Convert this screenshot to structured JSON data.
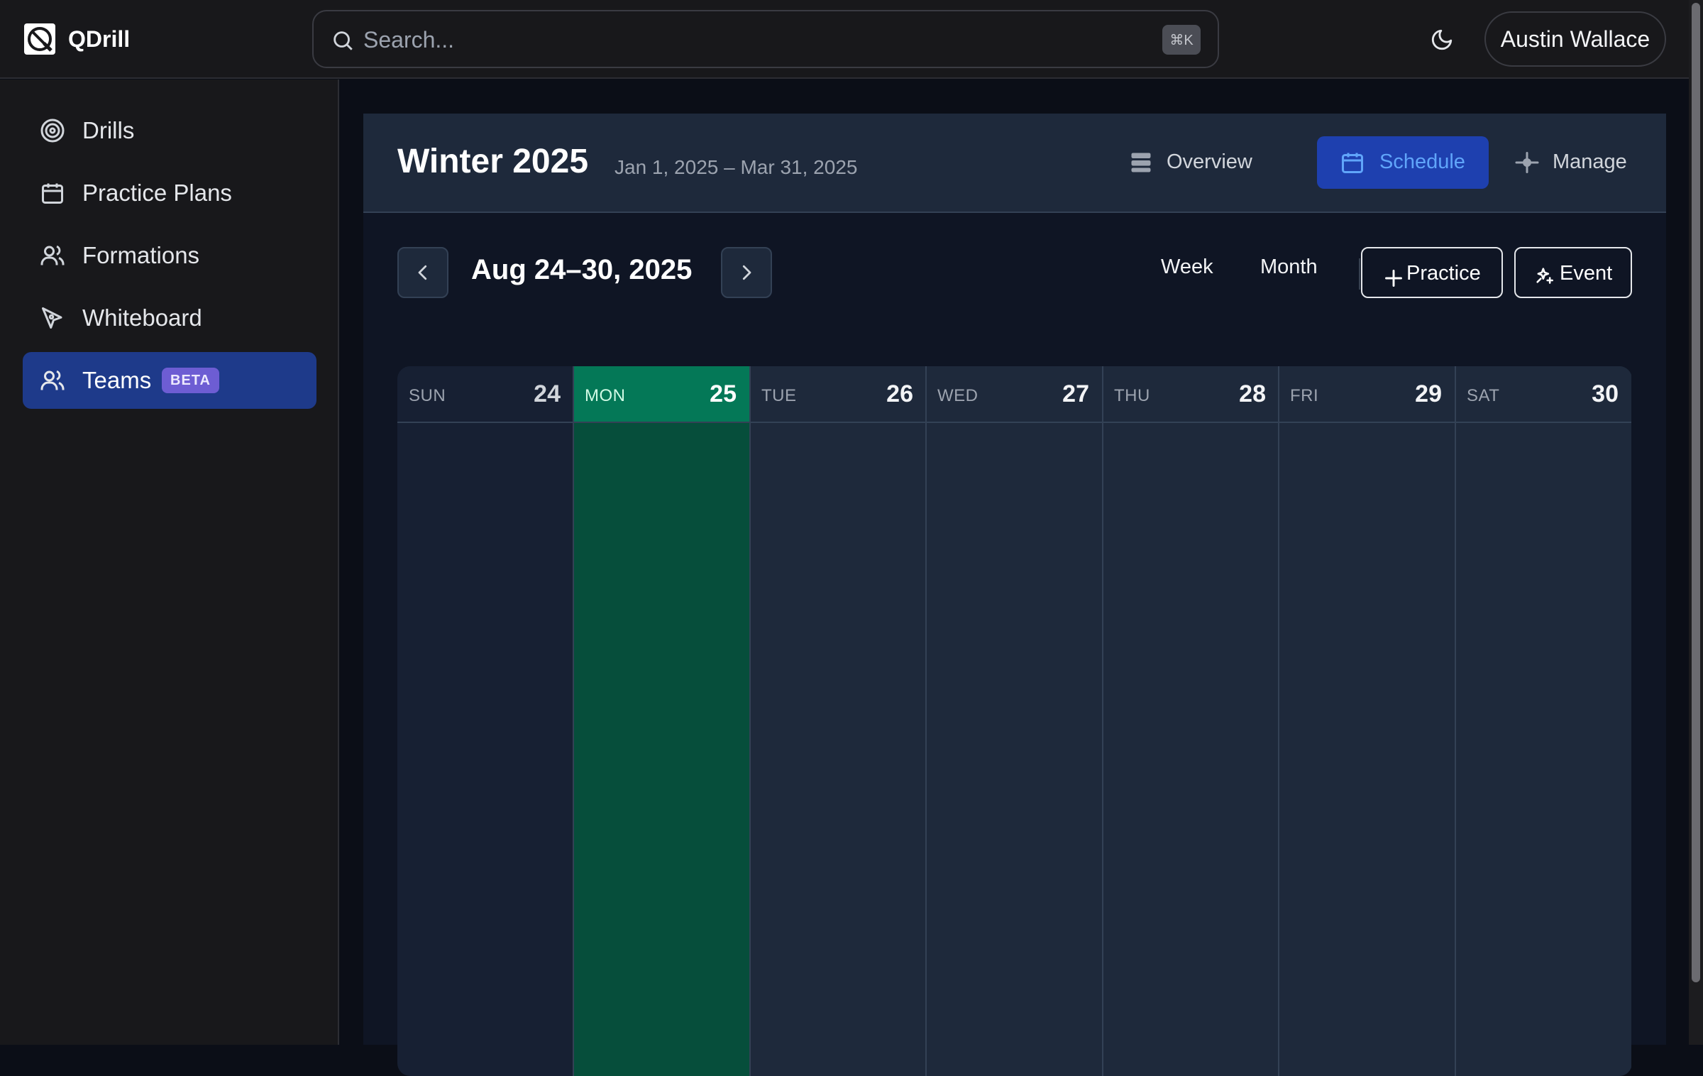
{
  "app": {
    "name": "QDrill",
    "search_placeholder": "Search...",
    "search_shortcut": "⌘K",
    "user_name": "Austin Wallace"
  },
  "sidebar": {
    "items": [
      {
        "label": "Drills",
        "icon": "target-icon"
      },
      {
        "label": "Practice Plans",
        "icon": "calendar-icon"
      },
      {
        "label": "Formations",
        "icon": "users-icon"
      },
      {
        "label": "Whiteboard",
        "icon": "pen-tool-icon"
      },
      {
        "label": "Teams",
        "icon": "users-icon",
        "badge": "BETA",
        "active": true
      }
    ]
  },
  "season": {
    "title": "Winter 2025",
    "dates": "Jan 1, 2025 – Mar 31, 2025"
  },
  "tabs": [
    {
      "label": "Overview",
      "active": false
    },
    {
      "label": "Schedule",
      "active": true
    },
    {
      "label": "Manage",
      "active": false
    }
  ],
  "schedule": {
    "range_label": "Aug 24–30, 2025",
    "view_week": "Week",
    "view_month": "Month",
    "add_practice": "Practice",
    "add_event": "Event",
    "days": [
      {
        "name": "SUN",
        "num": "24"
      },
      {
        "name": "MON",
        "num": "25",
        "today": true
      },
      {
        "name": "TUE",
        "num": "26"
      },
      {
        "name": "WED",
        "num": "27"
      },
      {
        "name": "THU",
        "num": "28"
      },
      {
        "name": "FRI",
        "num": "29"
      },
      {
        "name": "SAT",
        "num": "30"
      }
    ]
  },
  "colors": {
    "accent": "#1e40af",
    "active_nav": "#1e3a8a",
    "today_header": "#047857",
    "today_body": "#064e3b",
    "beta_badge": "#6d5dd3"
  }
}
